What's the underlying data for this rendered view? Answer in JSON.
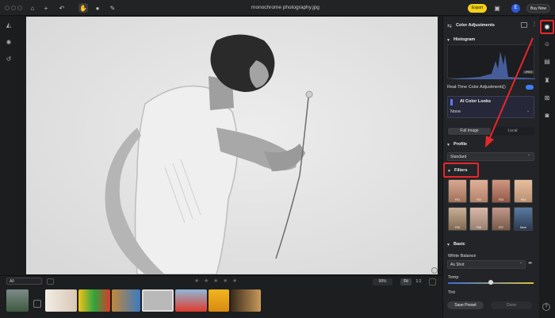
{
  "window": {
    "title": "monochrome photography.jpg"
  },
  "toolbar": {
    "export_label": "Export",
    "buy_label": "Buy Now",
    "avatar_letter": "E"
  },
  "bottom": {
    "filter_value": "All",
    "stars": [
      "★",
      "★",
      "★",
      "★",
      "★"
    ],
    "zoom": "98%",
    "fit_label": "Fit",
    "one_label": "1:1"
  },
  "panel": {
    "title": "Color Adjustments",
    "histogram_label": "Histogram",
    "histogram_tag": "JPEG",
    "realtime_label": "Real-Time Color Adjustments",
    "ai_looks_label": "AI Color Looks",
    "ai_looks_value": "None",
    "tabs": [
      "Full Image",
      "Local"
    ],
    "profile_label": "Profile",
    "profile_value": "Standard",
    "filters_label": "Filters",
    "filters": [
      "F01",
      "F02",
      "F03",
      "F04",
      "F05",
      "F06",
      "F07",
      "More"
    ],
    "basic_label": "Basic",
    "wb_label": "White Balance",
    "wb_value": "As Shot",
    "temp_label": "Temp",
    "tint_label": "Tint",
    "save_preset_label": "Save Preset",
    "done_label": "Done"
  },
  "colors": {
    "accent": "#f5d118",
    "highlight": "#e8262a",
    "toggle": "#3b7ef5"
  }
}
